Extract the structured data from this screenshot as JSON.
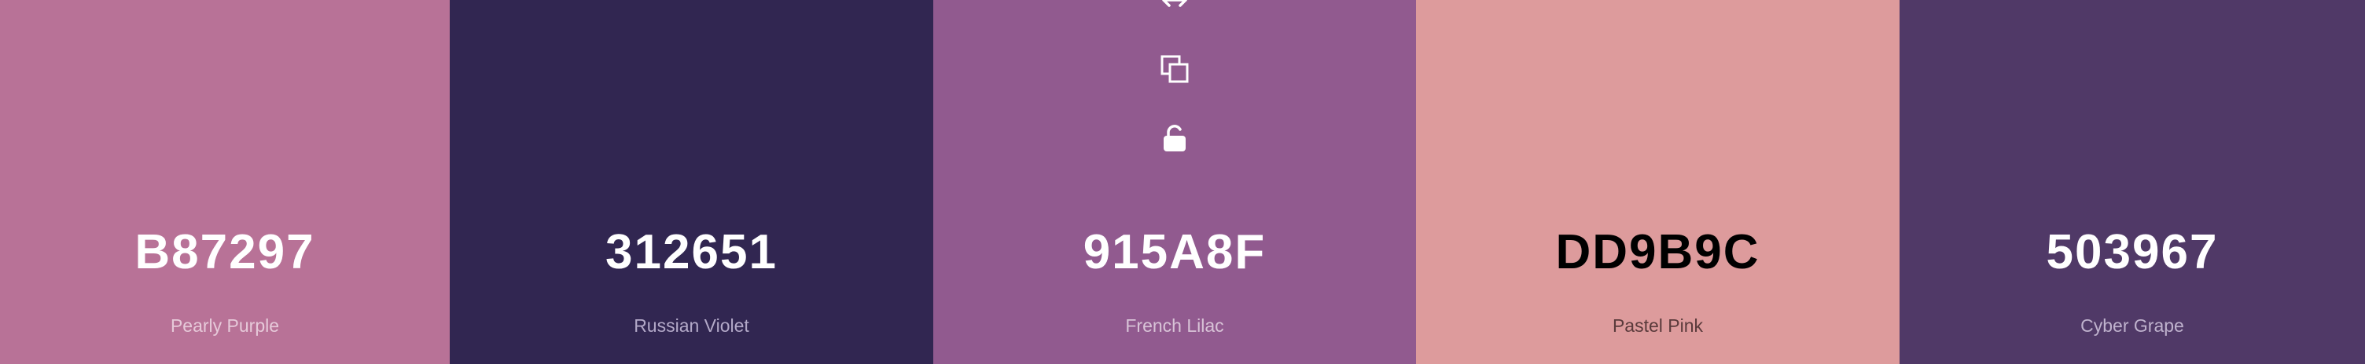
{
  "swatches": [
    {
      "hex": "B87297",
      "name": "Pearly Purple",
      "color": "#B87297",
      "text_color": "#FFFFFF",
      "name_color": "#E6C9D9"
    },
    {
      "hex": "312651",
      "name": "Russian Violet",
      "color": "#312651",
      "text_color": "#FFFFFF",
      "name_color": "#B3A9C8"
    },
    {
      "hex": "915A8F",
      "name": "French Lilac",
      "color": "#915A8F",
      "text_color": "#FFFFFF",
      "name_color": "#D8C3D7"
    },
    {
      "hex": "DD9B9C",
      "name": "Pastel Pink",
      "color": "#DD9B9C",
      "text_color": "#000000",
      "name_color": "#5A3A3B"
    },
    {
      "hex": "503967",
      "name": "Cyber Grape",
      "color": "#503967",
      "text_color": "#FFFFFF",
      "name_color": "#BFB2CD"
    }
  ],
  "active_swatch_tools": [
    "drag-icon",
    "copy-icon",
    "unlock-icon"
  ]
}
